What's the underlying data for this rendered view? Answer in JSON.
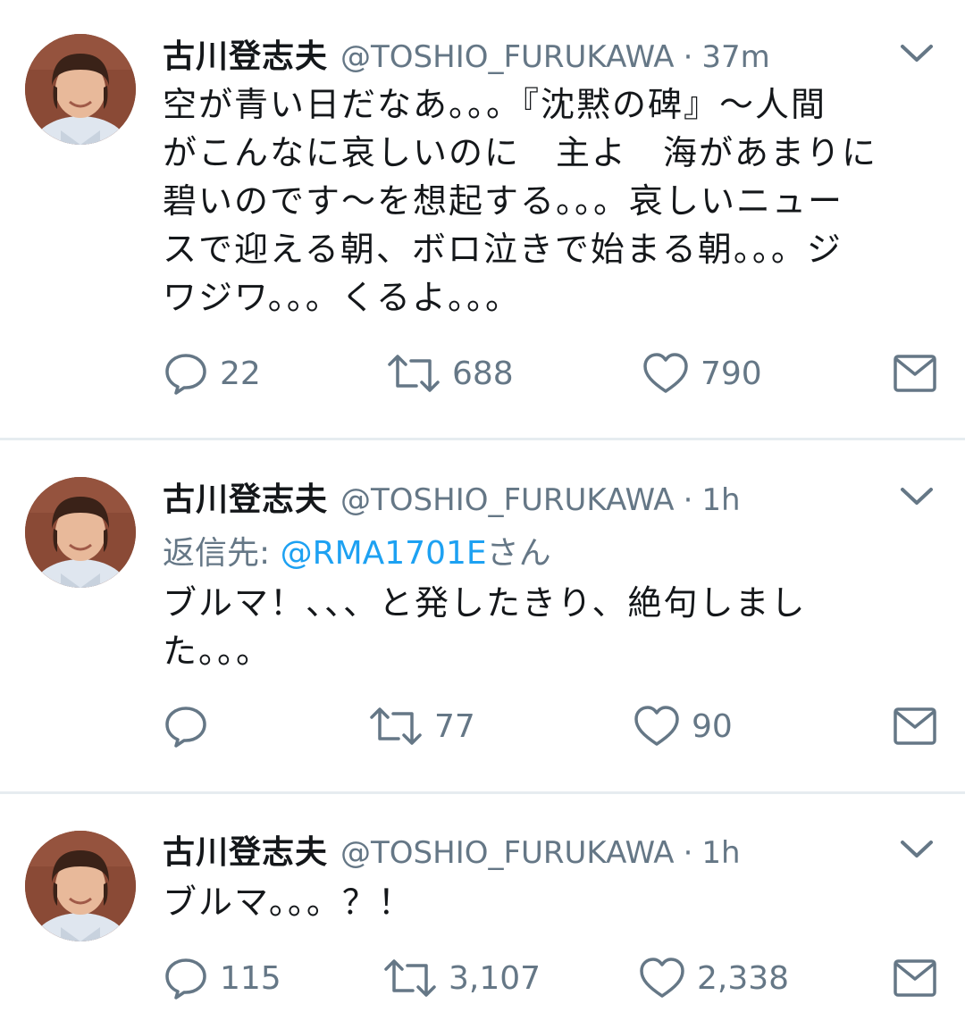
{
  "tweets": [
    {
      "name": "古川登志夫",
      "handle": "@TOSHIO_FURUKAWA",
      "separator": "·",
      "time": "37m",
      "lines": [
        "空が青い日だなあ。。。『沈黙の碑』〜人間",
        "がこんなに哀しいのに　主よ　海があまりに",
        "碧いのです〜を想起する。。。哀しいニュー",
        "スで迎える朝、ボロ泣きで始まる朝。。。ジ",
        "ワジワ。。。くるよ。。。"
      ],
      "replies": "22",
      "retweets": "688",
      "likes": "790"
    },
    {
      "name": "古川登志夫",
      "handle": "@TOSHIO_FURUKAWA",
      "separator": "·",
      "time": "1h",
      "reply_prefix": "返信先: ",
      "reply_mention": "@RMA1701E",
      "reply_suffix": "さん",
      "lines": [
        "ブルマ！、、、と発したきり、絶句しまし",
        "た。。。"
      ],
      "replies": "",
      "retweets": "77",
      "likes": "90"
    },
    {
      "name": "古川登志夫",
      "handle": "@TOSHIO_FURUKAWA",
      "separator": "·",
      "time": "1h",
      "lines": [
        "ブルマ。。。？！"
      ],
      "replies": "115",
      "retweets": "3,107",
      "likes": "2,338"
    }
  ],
  "icons": {
    "reply": "reply-icon",
    "retweet": "retweet-icon",
    "like": "heart-icon",
    "dm": "envelope-icon",
    "menu": "chevron-down-icon"
  },
  "colors": {
    "text": "#14171a",
    "secondary": "#657786",
    "link": "#1da1f2",
    "divider": "#e6ecf0"
  }
}
